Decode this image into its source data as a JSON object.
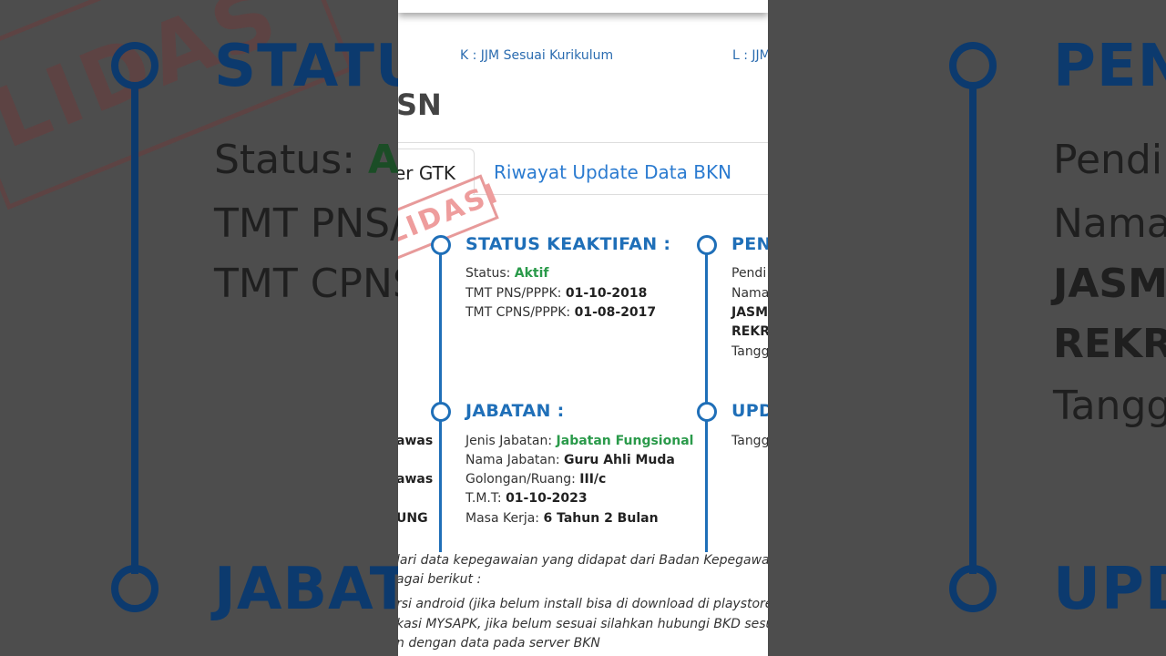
{
  "side_left": {
    "heading1": "STATU",
    "heading2": "JABAT",
    "line1_label": "Status: ",
    "line1_value": "Ak",
    "line2": "TMT PNS/",
    "line3": "TMT CPNS",
    "stamp": "LIDAS"
  },
  "side_right": {
    "heading1": "PEN",
    "heading2": "UPD",
    "line1": "Pendi",
    "line2": "Nama",
    "line3": "JASMA",
    "line4": "REKRE",
    "line5": "Tangg"
  },
  "legend": {
    "k": "K : JJM Sesuai Kurikulum",
    "l": "L : JJM"
  },
  "section_heading_fragment": "SN",
  "tabs": {
    "active_fragment": "er GTK",
    "bkn": "Riwayat Update Data BKN"
  },
  "stamp_text": "LIDASI",
  "status": {
    "title": "STATUS KEAKTIFAN :",
    "status_label": "Status:",
    "status_value": "Aktif",
    "tmt_pns_label": "TMT PNS/PPPK:",
    "tmt_pns_value": "01-10-2018",
    "tmt_cpns_label": "TMT CPNS/PPPK:",
    "tmt_cpns_value": "01-08-2017"
  },
  "pendidikan": {
    "title": "PEN",
    "row1": "Pendi",
    "row2": "Nama",
    "row3": "JASMA",
    "row4": "REKRI",
    "row5": "Tangg"
  },
  "jabatan": {
    "title": "JABATAN :",
    "jenis_label": "Jenis Jabatan:",
    "jenis_value": "Jabatan Fungsional",
    "nama_label": "Nama Jabatan:",
    "nama_value": "Guru Ahli Muda",
    "gol_label": "Golongan/Ruang:",
    "gol_value": "III/c",
    "tmt_label": "T.M.T:",
    "tmt_value": "01-10-2023",
    "masa_label": "Masa Kerja:",
    "masa_value": "6 Tahun 2 Bulan"
  },
  "update": {
    "title": "UPD",
    "row1": "Tangg"
  },
  "left_cut": {
    "r1": "awas",
    "r2": "awas",
    "r3": "UNG"
  },
  "notes": {
    "n1": "lari data kepegawaian yang didapat dari Badan Kepegawaian N",
    "n2": "agai berikut :",
    "n3": "rsi android (jika belum install bisa di download di playstore)",
    "n4": "kasi MYSAPK, jika belum sesuai silahkan hubungi BKD sesuai kew",
    "n5": "n dengan data pada server BKN"
  },
  "colors": {
    "accent_blue": "#1f6fb8",
    "link_blue": "#2b7bd0",
    "green": "#2a9a4a",
    "stamp_red": "#e79a9a"
  }
}
